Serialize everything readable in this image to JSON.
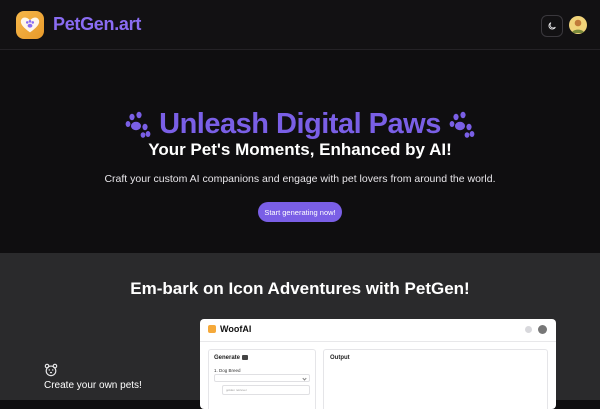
{
  "header": {
    "brand": "PetGen.art",
    "theme_icon": "moon-icon",
    "avatar_icon": "user-avatar-icon"
  },
  "hero": {
    "title": "Unleash Digital Paws",
    "subtitle": "Your Pet's Moments, Enhanced by AI!",
    "description": "Craft your custom AI companions and engage with pet lovers from around the world.",
    "cta_label": "Start generating now!"
  },
  "section2": {
    "title": "Em-bark on Icon Adventures with PetGen!",
    "feature_label": "Create your own pets!",
    "feature_icon": "bear-face-icon"
  },
  "preview": {
    "brand": "WoofAI",
    "generate_title": "Generate",
    "field1_label": "1. Dog Breed",
    "input_placeholder": "golden retriever",
    "output_title": "Output"
  },
  "colors": {
    "accent": "#7a5fe6",
    "brand_text": "#8a6cf2",
    "background": "#0f0e10",
    "section_bg": "#2a2a2c",
    "logo_gold": "#f5b74a"
  }
}
